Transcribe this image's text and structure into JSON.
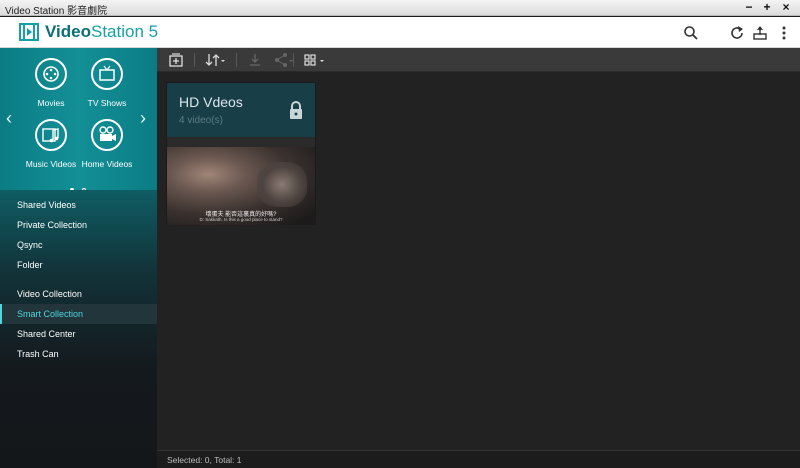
{
  "window": {
    "title": "Video Station 影音劇院",
    "controls": [
      "−",
      "+",
      "×"
    ]
  },
  "header": {
    "app_name_bold": "Video",
    "app_name_rest": "Station 5",
    "icons": [
      "search-icon",
      "refresh-icon",
      "upload-icon",
      "more-icon"
    ]
  },
  "nav_tiles": [
    {
      "label": "Movies",
      "icon": "film-reel-icon"
    },
    {
      "label": "TV Shows",
      "icon": "tv-icon"
    },
    {
      "label": "Music Videos",
      "icon": "music-video-icon"
    },
    {
      "label": "Home Videos",
      "icon": "camera-icon"
    }
  ],
  "menu": {
    "group1": [
      "Shared Videos",
      "Private Collection",
      "Qsync",
      "Folder"
    ],
    "group2": [
      "Video Collection",
      "Smart Collection",
      "Shared Center",
      "Trash Can"
    ],
    "active": "Smart Collection"
  },
  "toolbar": {
    "icons": [
      "add-collection-icon",
      "sort-icon",
      "download-icon",
      "share-icon",
      "view-mode-icon"
    ]
  },
  "collection_card": {
    "title": "HD Vdeos",
    "count": "4 video(s)",
    "subtitle_line1": "壞蛋夫 能否這裏真的好嗎?",
    "subtitle_line2": "D: Sakkath. Is this a good place to stand?"
  },
  "status": {
    "text": "Selected: 0, Total: 1"
  },
  "colors": {
    "accent": "#4fd6df",
    "sidebar_top": "#138f96",
    "card_head": "#183f48"
  }
}
